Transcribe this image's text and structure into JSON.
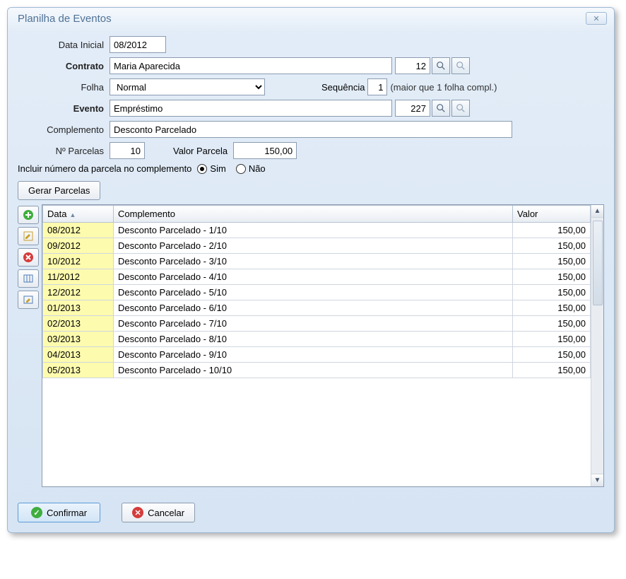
{
  "window": {
    "title": "Planilha de Eventos"
  },
  "labels": {
    "data_inicial": "Data Inicial",
    "contrato": "Contrato",
    "folha": "Folha",
    "sequencia": "Sequência",
    "seq_hint": "(maior que 1 folha compl.)",
    "evento": "Evento",
    "complemento": "Complemento",
    "n_parcelas": "Nº Parcelas",
    "valor_parcela": "Valor Parcela",
    "incluir_prompt": "Incluir número da parcela no complemento",
    "sim": "Sim",
    "nao": "Não",
    "gerar": "Gerar Parcelas",
    "confirmar": "Confirmar",
    "cancelar": "Cancelar"
  },
  "fields": {
    "data_inicial": "08/2012",
    "contrato_nome": "Maria Aparecida",
    "contrato_id": "12",
    "folha": "Normal",
    "sequencia": "1",
    "evento_nome": "Empréstimo",
    "evento_id": "227",
    "complemento": "Desconto Parcelado",
    "n_parcelas": "10",
    "valor_parcela": "150,00",
    "incluir_num_parcela": "sim"
  },
  "grid": {
    "headers": {
      "data": "Data",
      "complemento": "Complemento",
      "valor": "Valor"
    },
    "rows": [
      {
        "data": "08/2012",
        "complemento": "Desconto Parcelado - 1/10",
        "valor": "150,00"
      },
      {
        "data": "09/2012",
        "complemento": "Desconto Parcelado - 2/10",
        "valor": "150,00"
      },
      {
        "data": "10/2012",
        "complemento": "Desconto Parcelado - 3/10",
        "valor": "150,00"
      },
      {
        "data": "11/2012",
        "complemento": "Desconto Parcelado - 4/10",
        "valor": "150,00"
      },
      {
        "data": "12/2012",
        "complemento": "Desconto Parcelado - 5/10",
        "valor": "150,00"
      },
      {
        "data": "01/2013",
        "complemento": "Desconto Parcelado - 6/10",
        "valor": "150,00"
      },
      {
        "data": "02/2013",
        "complemento": "Desconto Parcelado - 7/10",
        "valor": "150,00"
      },
      {
        "data": "03/2013",
        "complemento": "Desconto Parcelado - 8/10",
        "valor": "150,00"
      },
      {
        "data": "04/2013",
        "complemento": "Desconto Parcelado - 9/10",
        "valor": "150,00"
      },
      {
        "data": "05/2013",
        "complemento": "Desconto Parcelado - 10/10",
        "valor": "150,00"
      }
    ]
  }
}
